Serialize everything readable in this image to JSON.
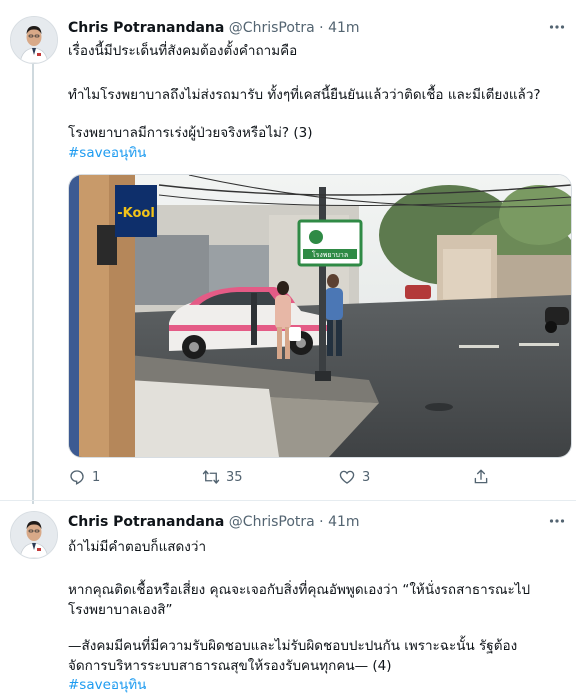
{
  "tweets": [
    {
      "author": "Chris Potranandana",
      "handle": "@ChrisPotra",
      "separator": "·",
      "time": "41m",
      "lines": [
        "เรื่องนี้มีประเด็นที่สังคมต้องตั้งคำถามคือ",
        "ทำไมโรงพยาบาลถึงไม่ส่งรถมารับ ทั้งๆที่เคสนี้ยืนยันแล้วว่าติดเชื้อ และมีเตียงแล้ว?",
        "โรงพยาบาลมีการเร่งผู้ป่วยจริงหรือไม่? (3)"
      ],
      "hashtag": "#saveอนุทิน",
      "media": {
        "shop_sign": "-Kool",
        "hospital_sign": "โรงพยาบาล"
      },
      "actions": {
        "reply_count": "1",
        "retweet_count": "35",
        "like_count": "3"
      }
    },
    {
      "author": "Chris Potranandana",
      "handle": "@ChrisPotra",
      "separator": "·",
      "time": "41m",
      "lines": [
        "ถ้าไม่มีคำตอบก็แสดงว่า",
        "หากคุณติดเชื้อหรือเสี่ยง คุณจะเจอกับสิ่งที่คุณอัพพูดเองว่า “ให้นั่งรถสาธารณะไป",
        "โรงพยาบาลเองสิ”",
        "—สังคมมีคนที่มีความรับผิดชอบและไม่รับผิดชอบปะปนกัน เพราะฉะนั้น รัฐต้อง",
        "จัดการบริหารระบบสาธารณสุขให้รองรับคนทุกคน— (4)"
      ],
      "hashtag": "#saveอนุทิน"
    }
  ],
  "icons": {
    "more": "more-dots-icon",
    "reply": "reply-icon",
    "retweet": "retweet-icon",
    "like": "heart-icon",
    "share": "share-icon"
  },
  "colors": {
    "link": "#1d9bf0",
    "secondary_text": "#536471",
    "thread_line": "#cfd9de"
  }
}
